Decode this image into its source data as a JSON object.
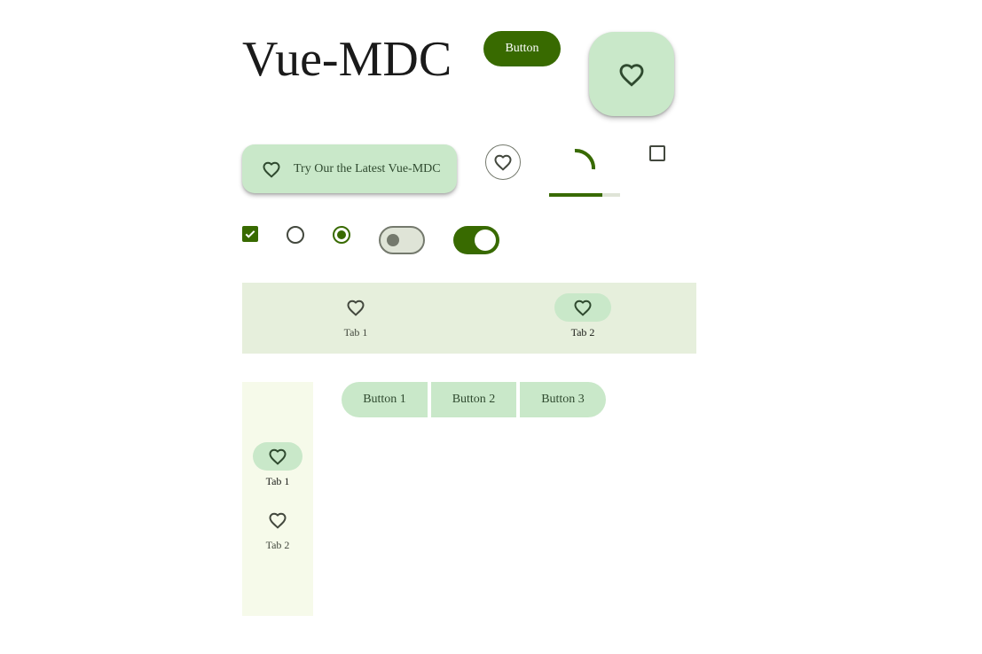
{
  "app": {
    "title": "Vue-MDC"
  },
  "colors": {
    "primary": "#386a00",
    "primary_container": "#c9e8c9",
    "surface_container": "#e6efdc",
    "rail_background": "#f6faea",
    "outline": "#74796d",
    "on_surface_variant": "#43483e"
  },
  "filled_button": {
    "label": "Button"
  },
  "fab": {
    "icon": "heart-outline-icon"
  },
  "extended_fab": {
    "icon": "heart-outline-icon",
    "label": "Try Our the Latest Vue-MDC"
  },
  "outlined_icon_button": {
    "icon": "heart-outline-icon"
  },
  "linear_progress": {
    "value": 0.75
  },
  "controls": {
    "checkbox_top": {
      "checked": false
    },
    "checkbox": {
      "checked": true
    },
    "radio_unselected": {
      "selected": false
    },
    "radio_selected": {
      "selected": true
    },
    "switch_off": {
      "on": false
    },
    "switch_on": {
      "on": true
    }
  },
  "navigation_bar": {
    "items": [
      {
        "label": "Tab 1",
        "icon": "heart-outline-icon",
        "active": false
      },
      {
        "label": "Tab 2",
        "icon": "heart-outline-icon",
        "active": true
      }
    ]
  },
  "navigation_rail": {
    "items": [
      {
        "label": "Tab 1",
        "icon": "heart-outline-icon",
        "active": true
      },
      {
        "label": "Tab 2",
        "icon": "heart-outline-icon",
        "active": false
      }
    ]
  },
  "segmented_buttons": {
    "items": [
      {
        "label": "Button 1"
      },
      {
        "label": "Button 2"
      },
      {
        "label": "Button 3"
      }
    ]
  }
}
